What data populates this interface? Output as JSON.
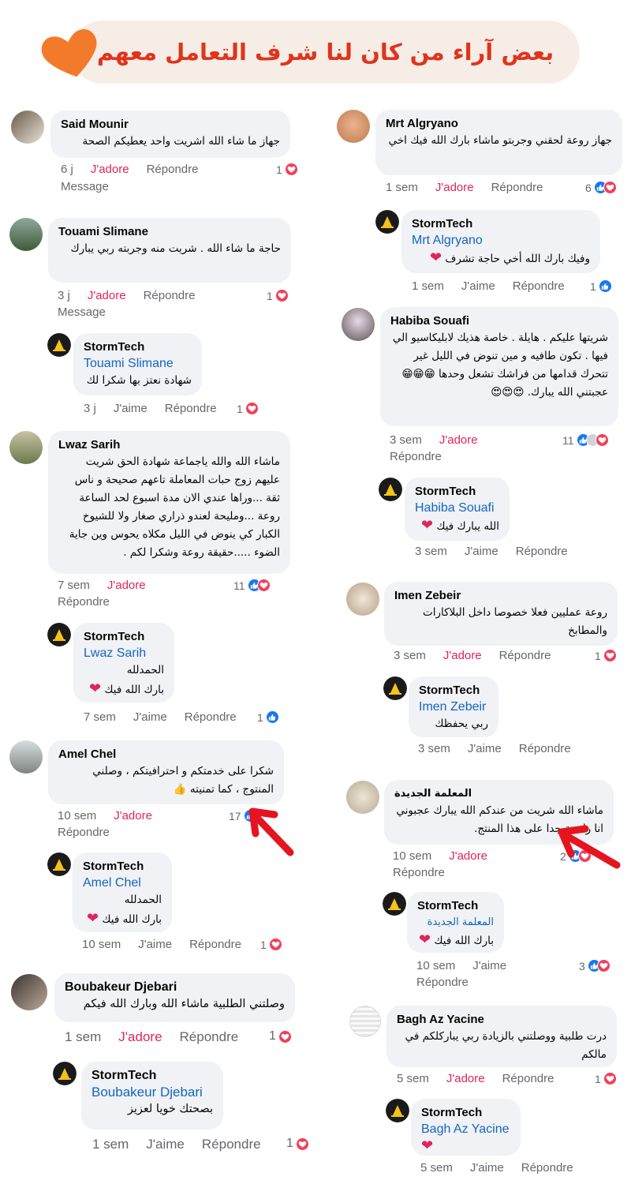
{
  "header": {
    "title": "بعض آراء من كان لنا شرف التعامل معهم",
    "accent": "#e0341c",
    "heart_color": "#f47a2b"
  },
  "colors": {
    "adore": "#e0245e",
    "mention": "#1565c0",
    "bubble": "#f0f2f5",
    "meta": "#65676b"
  },
  "left": [
    {
      "name": "Said Mounir",
      "text": "جهاز ما شاء الله اشريت واحد يعطيكم الصحة",
      "time": "6 j",
      "react_label": "J'adore",
      "reply_label": "Répondre",
      "extra": "Message",
      "count": "1"
    },
    {
      "name": "Touami Slimane",
      "text": "حاجة ما شاء الله . شريت منه وجربته ربي يبارك",
      "time": "3 j",
      "react_label": "J'adore",
      "reply_label": "Répondre",
      "extra": "Message",
      "count": "1",
      "reply": {
        "name": "StormTech",
        "mention": "Touami Slimane",
        "text": "شهادة نعتز بها شكرا لك",
        "time": "3 j",
        "like_label": "J'aime",
        "reply_label": "Répondre",
        "count": "1"
      }
    },
    {
      "name": "Lwaz Sarih",
      "text": "ماشاء الله والله ياجماعة شهادة الحق شريت عليهم زوج حبات المعاملة تاعهم صحيحة و ناس ثقة ...وراها عندي الان مدة اسبوع لحد الساعة روعة ...ومليحة لعندو ذراري صغار ولا للشيوخ الكبار كي ينوض في الليل مكلاه يحوس وين جاية الضوء .....حقيقة روعة وشكرا لكم .",
      "time": "7 sem",
      "react_label": "J'adore",
      "reply_label": "Répondre",
      "count": "11",
      "reply": {
        "name": "StormTech",
        "mention": "Lwaz Sarih",
        "text1": "الحمدلله",
        "text2": "بارك الله فيك",
        "time": "7 sem",
        "like_label": "J'aime",
        "reply_label": "Répondre",
        "count": "1"
      }
    },
    {
      "name": "Amel Chel",
      "text": "شكرا على خدمتكم و احترافيتكم ، وصلني المنتوج ، كما تمنيته 👍",
      "time": "10 sem",
      "react_label": "J'adore",
      "reply_label": "Répondre",
      "count": "17",
      "reply": {
        "name": "StormTech",
        "mention": "Amel Chel",
        "text1": "الحمدلله",
        "text2": "بارك الله فيك",
        "time": "10 sem",
        "like_label": "J'aime",
        "reply_label": "Répondre",
        "count": "1"
      }
    },
    {
      "name": "Boubakeur Djebari",
      "text": "وصلتني الطلبية ماشاء الله وبارك الله فيكم",
      "time": "1 sem",
      "react_label": "J'adore",
      "reply_label": "Répondre",
      "count": "1",
      "reply": {
        "name": "StormTech",
        "mention": "Boubakeur Djebari",
        "text": "بصحتك خويا لعزيز",
        "time": "1 sem",
        "like_label": "J'aime",
        "reply_label": "Répondre",
        "count": "1"
      }
    }
  ],
  "right": [
    {
      "name": "Mrt Algryano",
      "text": "جهاز روعة لحقني وجربتو ماشاء بارك الله فيك اخي",
      "time": "1 sem",
      "react_label": "J'adore",
      "reply_label": "Répondre",
      "count": "6",
      "reply": {
        "name": "StormTech",
        "mention": "Mrt Algryano",
        "text": "وفيك بارك الله أخي حاجة تشرف",
        "time": "1 sem",
        "like_label": "J'aime",
        "reply_label": "Répondre",
        "count": "1"
      }
    },
    {
      "name": "Habiba Souafi",
      "text": "شريتها عليكم . هايلة . خاصة هذيك لابليكاسيو الي فيها . تكون طافيه و مين تنوض في الليل غير تتحرك قدامها من فراشك تشعل وحدها 😁😁😁 عجبتني الله يبارك. 😍😍😍",
      "time": "3 sem",
      "react_label": "J'adore",
      "reply_label": "Répondre",
      "count": "11",
      "reply": {
        "name": "StormTech",
        "mention": "Habiba Souafi",
        "text": "الله يبارك فيك",
        "time": "3 sem",
        "like_label": "J'aime",
        "reply_label": "Répondre"
      }
    },
    {
      "name": "Imen Zebeir",
      "text": "روعة عمليين فعلا خصوصا داخل البلاكارات والمطابخ",
      "time": "3 sem",
      "react_label": "J'adore",
      "reply_label": "Répondre",
      "count": "1",
      "reply": {
        "name": "StormTech",
        "mention": "Imen Zebeir",
        "text": "ربي يحفظك",
        "time": "3 sem",
        "like_label": "J'aime",
        "reply_label": "Répondre"
      }
    },
    {
      "name": "المعلمة الجديدة",
      "text": "ماشاء الله شريت من عندكم الله يبارك عجبوني انا راضية جدا على هذا المنتج.",
      "time": "10 sem",
      "react_label": "J'adore",
      "reply_label": "Répondre",
      "count": "2",
      "reply": {
        "name": "StormTech",
        "mention": "المعلمة الجديدة",
        "text": "بارك الله فيك",
        "time": "10 sem",
        "like_label": "J'aime",
        "reply_label": "Répondre",
        "count": "3"
      }
    },
    {
      "name": "Bagh Az Yacine",
      "text": "درت طلبية ووصلتني بالزيادة ربي يباركلكم في مالكم",
      "time": "5 sem",
      "react_label": "J'adore",
      "reply_label": "Répondre",
      "count": "1",
      "reply": {
        "name": "StormTech",
        "mention": "Bagh Az Yacine",
        "time": "5 sem",
        "like_label": "J'aime",
        "reply_label": "Répondre"
      }
    }
  ]
}
